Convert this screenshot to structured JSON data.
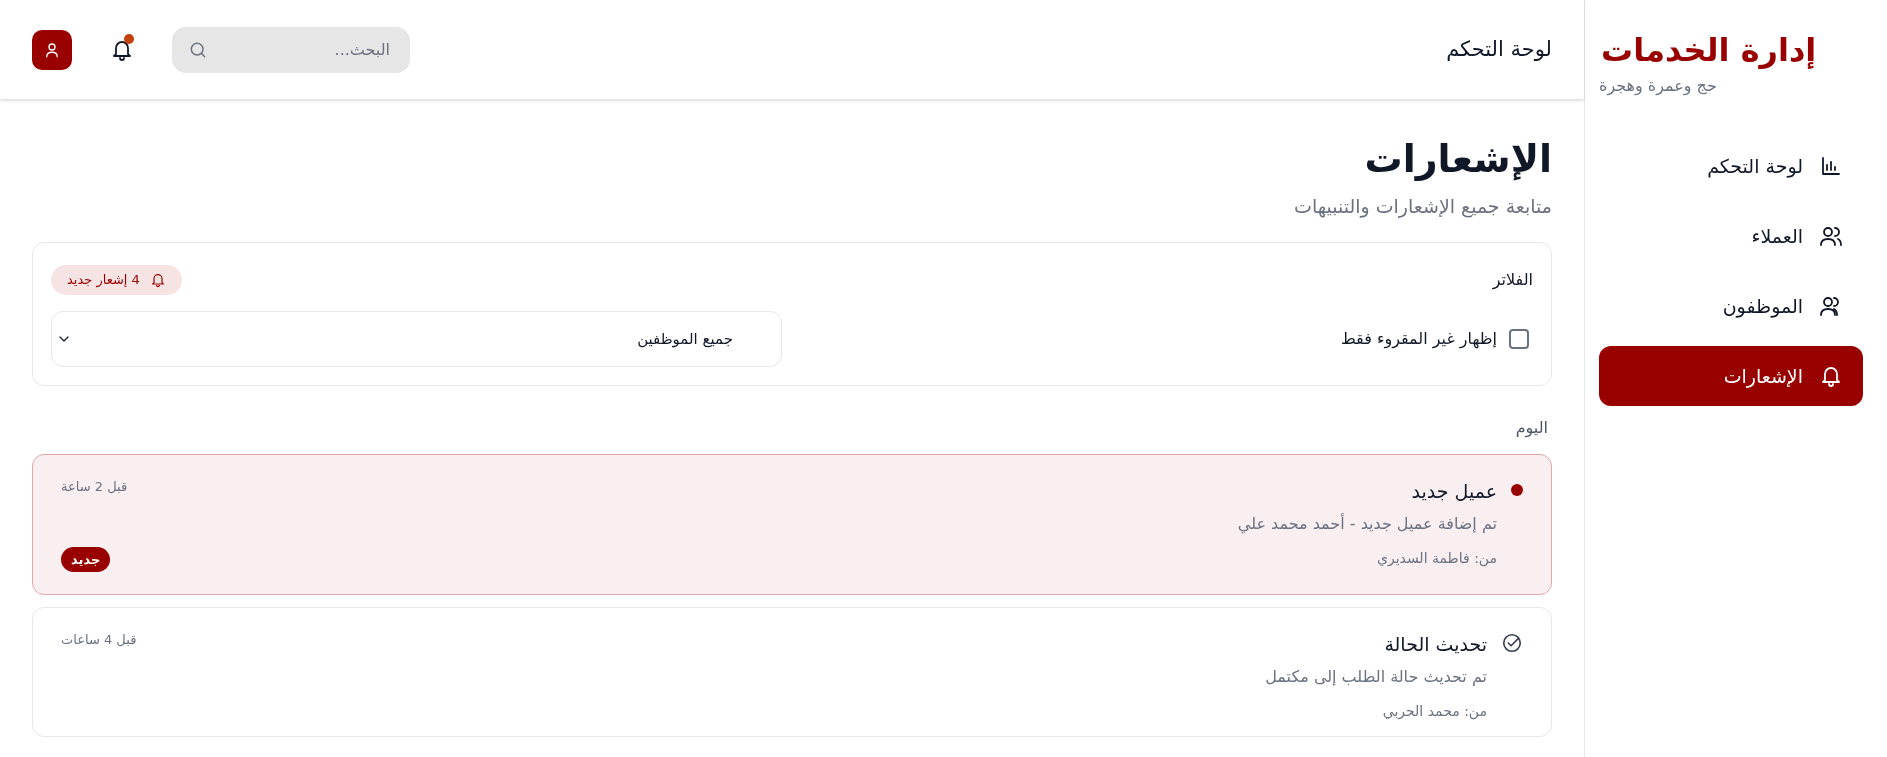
{
  "sidebar": {
    "title": "إدارة الخدمات",
    "subtitle": "حج وعمرة وهجرة",
    "items": [
      {
        "label": "لوحة التحكم",
        "kind": "chart",
        "selected": false
      },
      {
        "label": "العملاء",
        "kind": "users",
        "selected": false
      },
      {
        "label": "الموظفون",
        "kind": "users2",
        "selected": false
      },
      {
        "label": "الإشعارات",
        "kind": "bell",
        "selected": true
      }
    ]
  },
  "header": {
    "title": "لوحة التحكم",
    "search": {
      "placeholder": "البحث..."
    },
    "notifications_dot": true
  },
  "page": {
    "title": "الإشعارات",
    "subtitle": "متابعة جميع الإشعارات والتنبيهات"
  },
  "filters": {
    "title": "الفلاتر",
    "badge": "4 إشعار جديد",
    "unread_only": {
      "label": "إظهار غير المقروء فقط",
      "checked": false
    },
    "employee_select": {
      "value": "جميع الموظفين"
    }
  },
  "groups": [
    {
      "label": "اليوم",
      "notifications": [
        {
          "title": "عميل جديد",
          "message": "تم إضافة عميل جديد - أحمد محمد علي",
          "from": "من: فاطمة السديري",
          "time": "قبل 2 ساعة",
          "unread": true,
          "badge": "جديد"
        },
        {
          "title": "تحديث الحالة",
          "message": "تم تحديث حالة الطلب إلى مكتمل",
          "from": "من: محمد الحربي",
          "time": "قبل 4 ساعات",
          "unread": false
        }
      ]
    }
  ]
}
